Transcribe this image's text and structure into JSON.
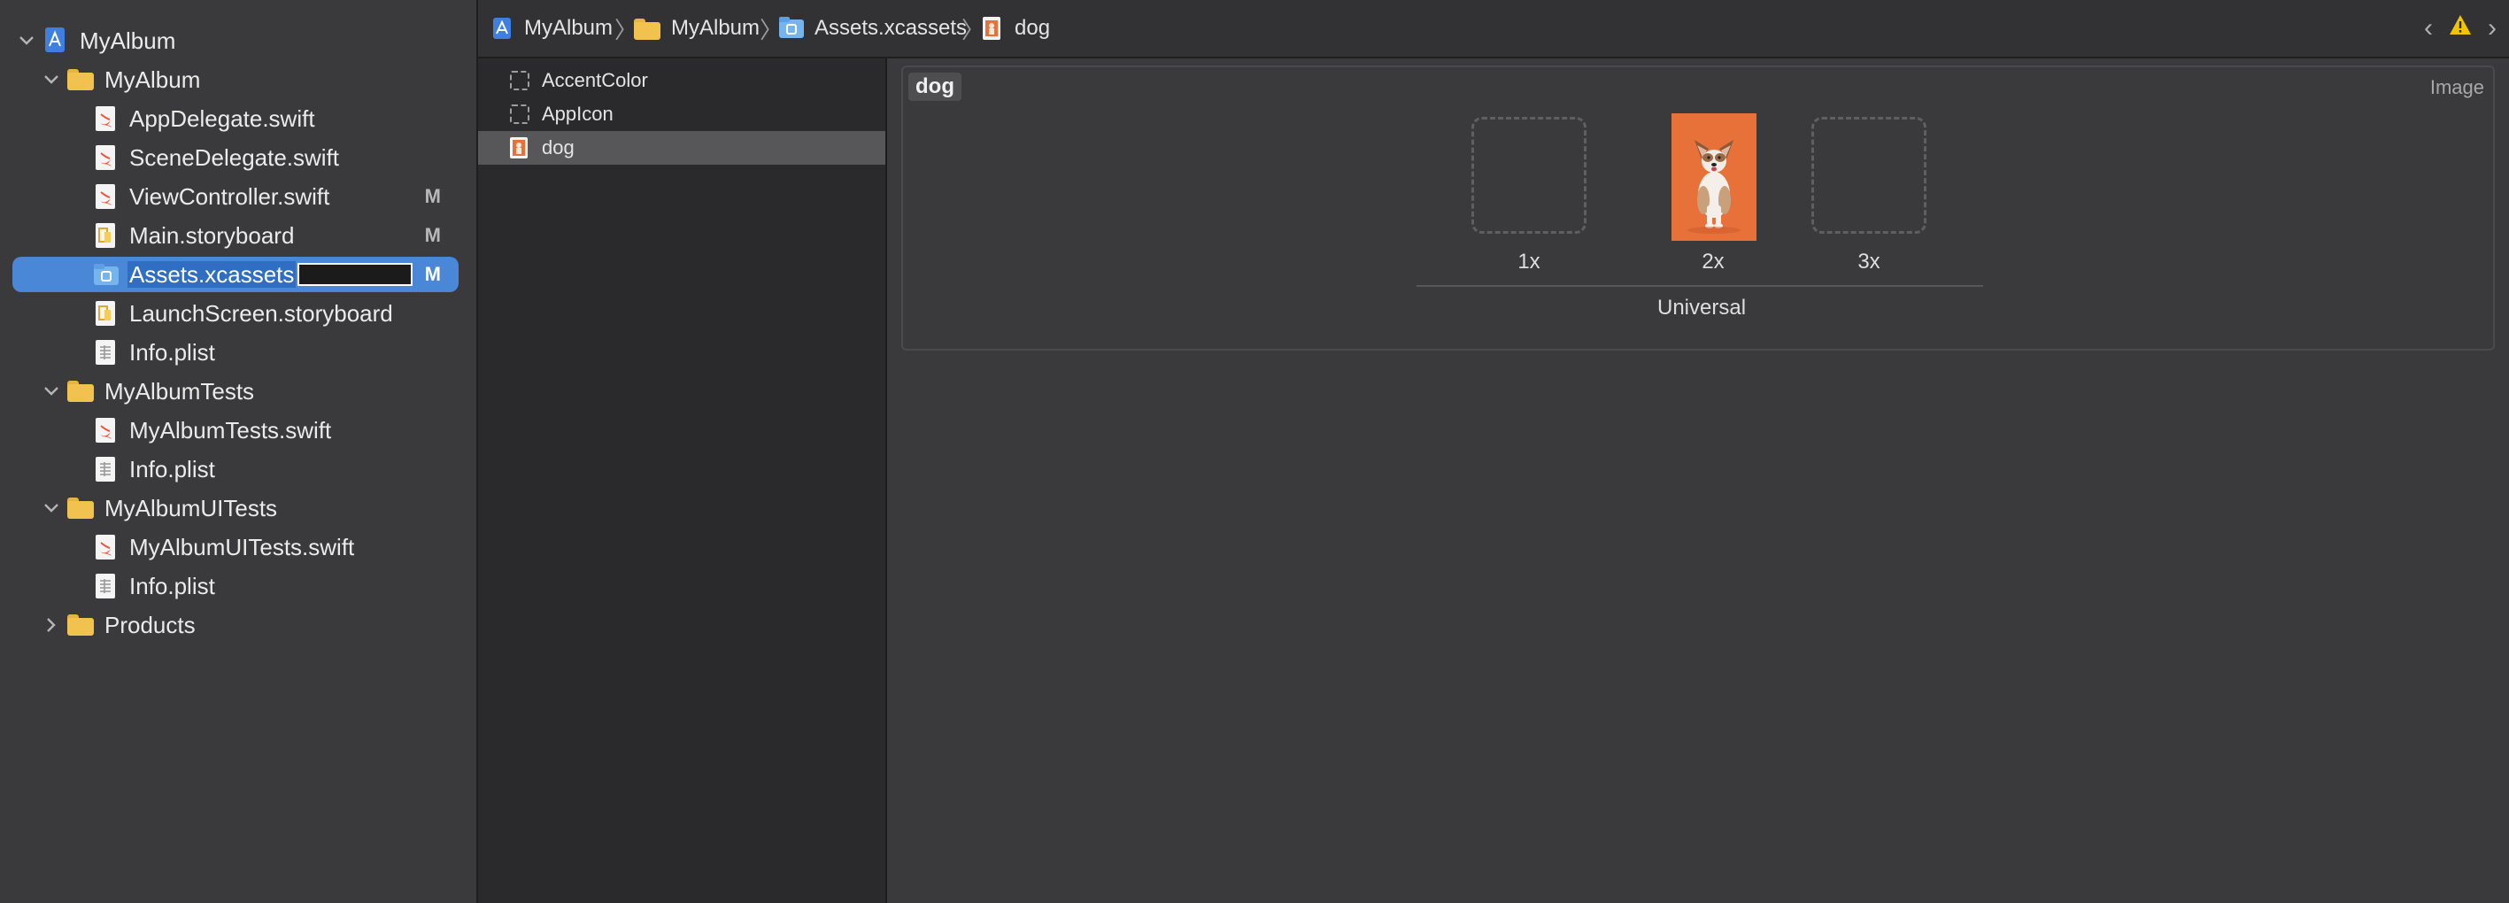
{
  "navigator": {
    "items": [
      {
        "label": "MyAlbum",
        "kind": "project",
        "disclosure": "open",
        "badge": ""
      },
      {
        "label": "MyAlbum",
        "kind": "folder",
        "disclosure": "open",
        "badge": ""
      },
      {
        "label": "AppDelegate.swift",
        "kind": "swift",
        "badge": ""
      },
      {
        "label": "SceneDelegate.swift",
        "kind": "swift",
        "badge": ""
      },
      {
        "label": "ViewController.swift",
        "kind": "swift",
        "badge": "M"
      },
      {
        "label": "Main.storyboard",
        "kind": "storyboard",
        "badge": "M"
      },
      {
        "label": "Assets.xcassets",
        "kind": "assets",
        "badge": "M",
        "selected": true
      },
      {
        "label": "LaunchScreen.storyboard",
        "kind": "storyboard",
        "badge": ""
      },
      {
        "label": "Info.plist",
        "kind": "plist",
        "badge": ""
      },
      {
        "label": "MyAlbumTests",
        "kind": "folder",
        "disclosure": "open",
        "badge": ""
      },
      {
        "label": "MyAlbumTests.swift",
        "kind": "swift",
        "badge": ""
      },
      {
        "label": "Info.plist",
        "kind": "plist",
        "badge": ""
      },
      {
        "label": "MyAlbumUITests",
        "kind": "folder",
        "disclosure": "open",
        "badge": ""
      },
      {
        "label": "MyAlbumUITests.swift",
        "kind": "swift",
        "badge": ""
      },
      {
        "label": "Info.plist",
        "kind": "plist",
        "badge": ""
      },
      {
        "label": "Products",
        "kind": "folder",
        "disclosure": "closed",
        "badge": ""
      }
    ]
  },
  "jumpbar": {
    "crumbs": [
      "MyAlbum",
      "MyAlbum",
      "Assets.xcassets",
      "dog"
    ],
    "icons": [
      "project-icon",
      "folder-icon",
      "assets-icon",
      "image-file-icon"
    ]
  },
  "assets": {
    "items": [
      {
        "label": "AccentColor",
        "icon": "color-set-icon"
      },
      {
        "label": "AppIcon",
        "icon": "app-icon-set-icon"
      },
      {
        "label": "dog",
        "icon": "image-set-icon",
        "selected": true
      }
    ]
  },
  "editor": {
    "set_name": "dog",
    "set_type": "Image",
    "slots": [
      {
        "label": "1x",
        "filled": false
      },
      {
        "label": "2x",
        "filled": true
      },
      {
        "label": "3x",
        "filled": false
      }
    ],
    "group_label": "Universal"
  },
  "colors": {
    "accent": "#4a87d6",
    "warning": "#f5c400",
    "photo_bg": "#e8713a"
  }
}
